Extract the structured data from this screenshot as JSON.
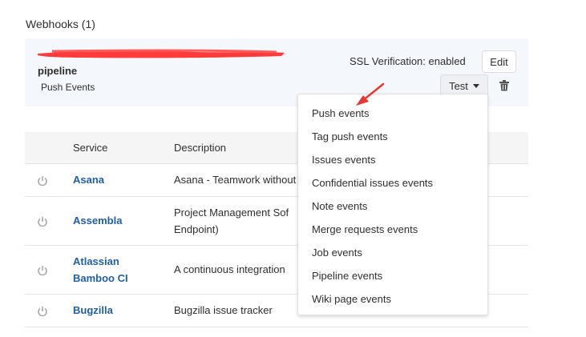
{
  "section": {
    "title": "Webhooks (1)"
  },
  "webhook": {
    "name": "pipeline",
    "events": "Push Events",
    "ssl": "SSL Verification: enabled",
    "edit_label": "Edit",
    "test_label": "Test",
    "redaction_color": "#ff3b3b"
  },
  "table": {
    "headers": {
      "service": "Service",
      "description": "Description"
    },
    "rows": [
      {
        "name": "Asana",
        "description": "Asana - Teamwork without"
      },
      {
        "name": "Assembla",
        "description_line1": "Project Management Sof",
        "description_line2": "Endpoint)"
      },
      {
        "name_line1": "Atlassian",
        "name_line2": "Bamboo CI",
        "description": "A continuous integration"
      },
      {
        "name": "Bugzilla",
        "description": "Bugzilla issue tracker"
      }
    ]
  },
  "dropdown": {
    "items": [
      "Push events",
      "Tag push events",
      "Issues events",
      "Confidential issues events",
      "Note events",
      "Merge requests events",
      "Job events",
      "Pipeline events",
      "Wiki page events"
    ]
  },
  "colors": {
    "link": "#1f5fa3",
    "panel": "#f4f7fb",
    "annotation_arrow": "#e53935"
  }
}
